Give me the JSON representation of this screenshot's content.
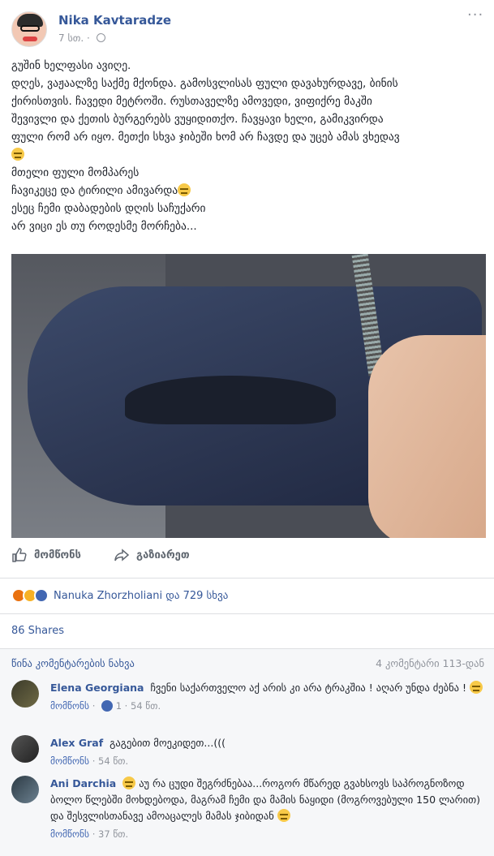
{
  "post": {
    "author": "Nika Kavtaradze",
    "time": "7 სთ. ·",
    "more": "···",
    "text_lines": [
      "გუშინ ხელფასი ავიღე.",
      "დღეს, ვაჟაალზე საქმე მქონდა. გამოსვლისას ფული დავახურდავე, ბინის",
      "ქირისთვის. ჩავედი მეტროში. რუსთაველზე ამოვედი, ვიფიქრე მაკში",
      "შევივლი და ქეთის ბურგერებს ვუყიდითქო. ჩავყავი ხელი, გამიკვირდა",
      "ფული რომ არ იყო. მეთქი სხვა ჯიბეში ხომ არ ჩავდე და უცებ ამას ვხედავ",
      "",
      "მთელი ფული მომპარეს",
      "ჩავიკეცე და ტირილი ამივარდა",
      "ესეც ჩემი დაბადების დღის საჩუქარი",
      "არ ვიცი ეს თუ როდესმე მორჩება..."
    ]
  },
  "actions": {
    "like": "მომწონს",
    "share": "გაზიარეთ"
  },
  "reactions": {
    "names": "Nanuka Zhorzholiani და 729 სხვა"
  },
  "shares": "86 Shares",
  "comments": {
    "prev_label": "წინა კომენტარების ნახვა",
    "count_label": "4 კომენტარი 113-დან",
    "items": [
      {
        "name": "Elena Georgiana",
        "text": "ჩვენი საქართველო აქ არის კი არა ტრაკშია ! აღარ უნდა ძებნა !",
        "like_label": "მომწონს",
        "likes": "1",
        "time": "54 წთ."
      },
      {
        "name": "Alex Graf",
        "text": "გაგებით მოეკიდეთ...(((",
        "like_label": "მომწონს",
        "time": "54 წთ."
      },
      {
        "name": "Ani Darchia",
        "text": "აუ რა ცუდი შეგრძნებაა...როგორ მწარედ გვახსოვს საპროგნოზოდ ბოლო წლებში მოხდებოდა, მაგრამ ჩემი და მამის ნაყიდი (მოგროვებული 150 ლარით) და შესვლისთანავე ამოაცალეს მამას ჯიბიდან",
        "like_label": "მომწონს",
        "time": "37 წთ."
      }
    ]
  },
  "colors": {
    "link": "#365899",
    "muted": "#90949c",
    "divider": "#dddfe2"
  }
}
